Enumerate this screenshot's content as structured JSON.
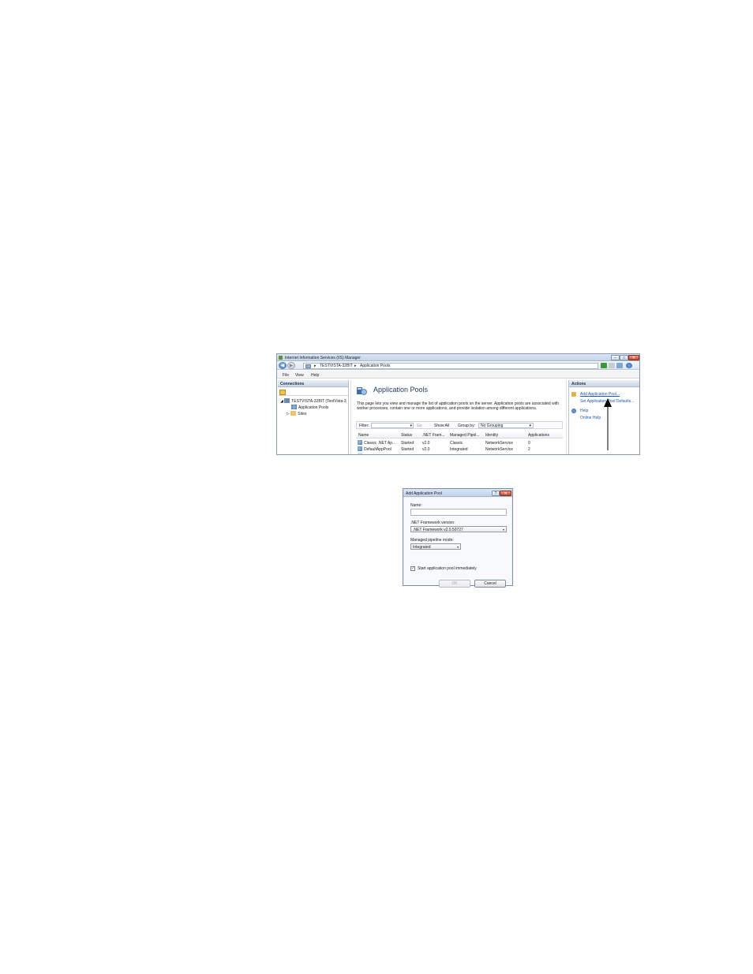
{
  "iis": {
    "title": "Internet Information Services (IIS) Manager",
    "window_buttons": {
      "minimize": "–",
      "maximize": "□",
      "close": "✕"
    },
    "address": {
      "crumbs": [
        "TESTVISTA-32BIT",
        "Application Pools"
      ],
      "separator": "▸"
    },
    "menu": [
      "File",
      "View",
      "Help"
    ],
    "connections": {
      "header": "Connections",
      "tree": [
        {
          "label": "TESTVISTA-32BIT (TestVista-3",
          "expander": "◢"
        },
        {
          "label": "Application Pools",
          "expander": ""
        },
        {
          "label": "Sites",
          "expander": "▷"
        }
      ]
    },
    "main": {
      "title": "Application Pools",
      "description": "This page lets you view and manage the list of application pools on the server. Application pools are associated with worker processes, contain one or more applications, and provide isolation among different applications.",
      "filter": {
        "label": "Filter:",
        "go_label": "Go",
        "show_all_label": "Show All",
        "group_by_label": "Group by:",
        "group_by_value": "No Grouping"
      },
      "columns": [
        "Name",
        "Status",
        ".NET Fram...",
        "Managed Pipel...",
        "Identity",
        "Applications"
      ],
      "rows": [
        [
          "Classic .NET Ap...",
          "Started",
          "v2.0",
          "Classic",
          "NetworkService",
          "0"
        ],
        [
          "DefaultAppPool",
          "Started",
          "v2.0",
          "Integrated",
          "NetworkService",
          "2"
        ]
      ]
    },
    "actions": {
      "header": "Actions",
      "items": [
        "Add Application Pool...",
        "Set Application Pool Defaults...",
        "Help",
        "Online Help"
      ]
    }
  },
  "dialog": {
    "title": "Add Application Pool",
    "help_button": "?",
    "close_button": "✕",
    "name_label": "Name:",
    "name_value": "",
    "framework_label": ".NET Framework version:",
    "framework_value": ".NET Framework v2.0.50727",
    "pipeline_label": "Managed pipeline mode:",
    "pipeline_value": "Integrated",
    "start_checkbox_label": "Start application pool immediately",
    "start_checked_mark": "✓",
    "ok_label": "OK",
    "cancel_label": "Cancel"
  },
  "icons": {
    "dropdown_arrow": "▾",
    "back_arrow": "◀",
    "forward_arrow": "▶"
  }
}
